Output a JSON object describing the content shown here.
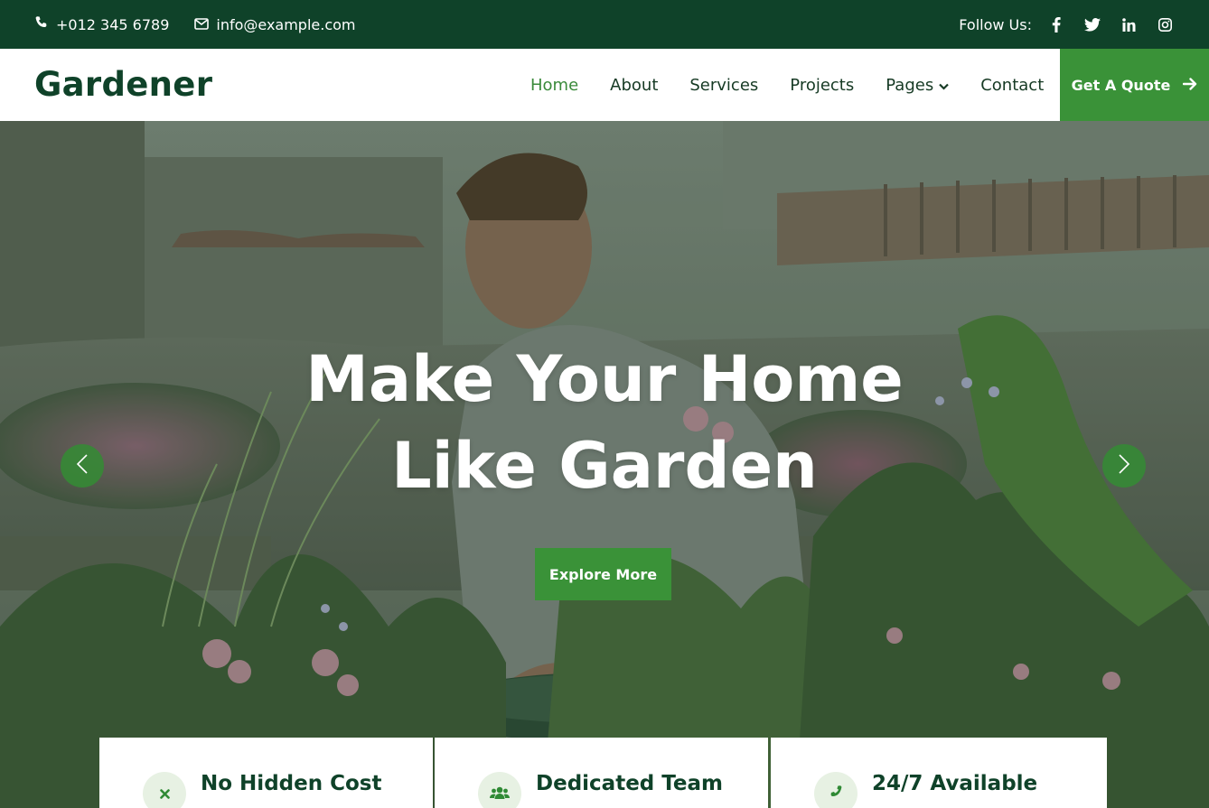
{
  "topbar": {
    "phone": "+012 345 6789",
    "email": "info@example.com",
    "follow_label": "Follow Us:",
    "social": [
      "facebook-icon",
      "twitter-icon",
      "linkedin-icon",
      "instagram-icon"
    ]
  },
  "navbar": {
    "brand": "Gardener",
    "links": [
      {
        "label": "Home",
        "active": true
      },
      {
        "label": "About"
      },
      {
        "label": "Services"
      },
      {
        "label": "Projects"
      },
      {
        "label": "Pages",
        "dropdown": true
      },
      {
        "label": "Contact"
      }
    ],
    "quote_button": "Get A Quote"
  },
  "hero": {
    "title_line1": "Make Your Home",
    "title_line2": "Like Garden",
    "cta": "Explore More"
  },
  "features": [
    {
      "title": "No Hidden Cost",
      "icon": "times-icon"
    },
    {
      "title": "Dedicated Team",
      "icon": "users-icon"
    },
    {
      "title": "24/7 Available",
      "icon": "phone-icon"
    }
  ],
  "colors": {
    "primary_dark": "#0f4229",
    "accent_green": "#3a9238",
    "active_link": "#3a8a3a"
  }
}
